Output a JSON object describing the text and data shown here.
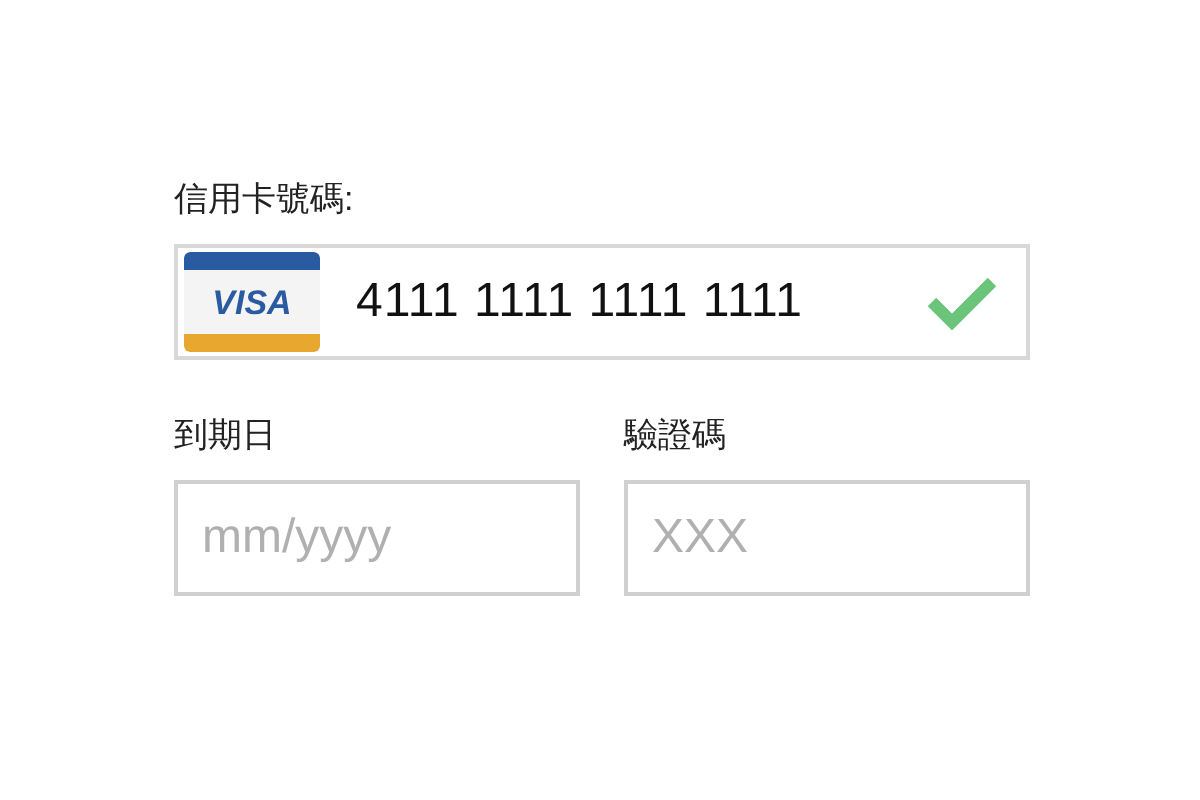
{
  "card_number": {
    "label": "信用卡號碼:",
    "value": "4111 1111 1111 1111",
    "brand": "VISA",
    "valid": true
  },
  "fields": [
    {
      "label": "到期日",
      "placeholder": "mm/yyyy"
    },
    {
      "label": "驗證碼",
      "placeholder": "XXX"
    }
  ]
}
